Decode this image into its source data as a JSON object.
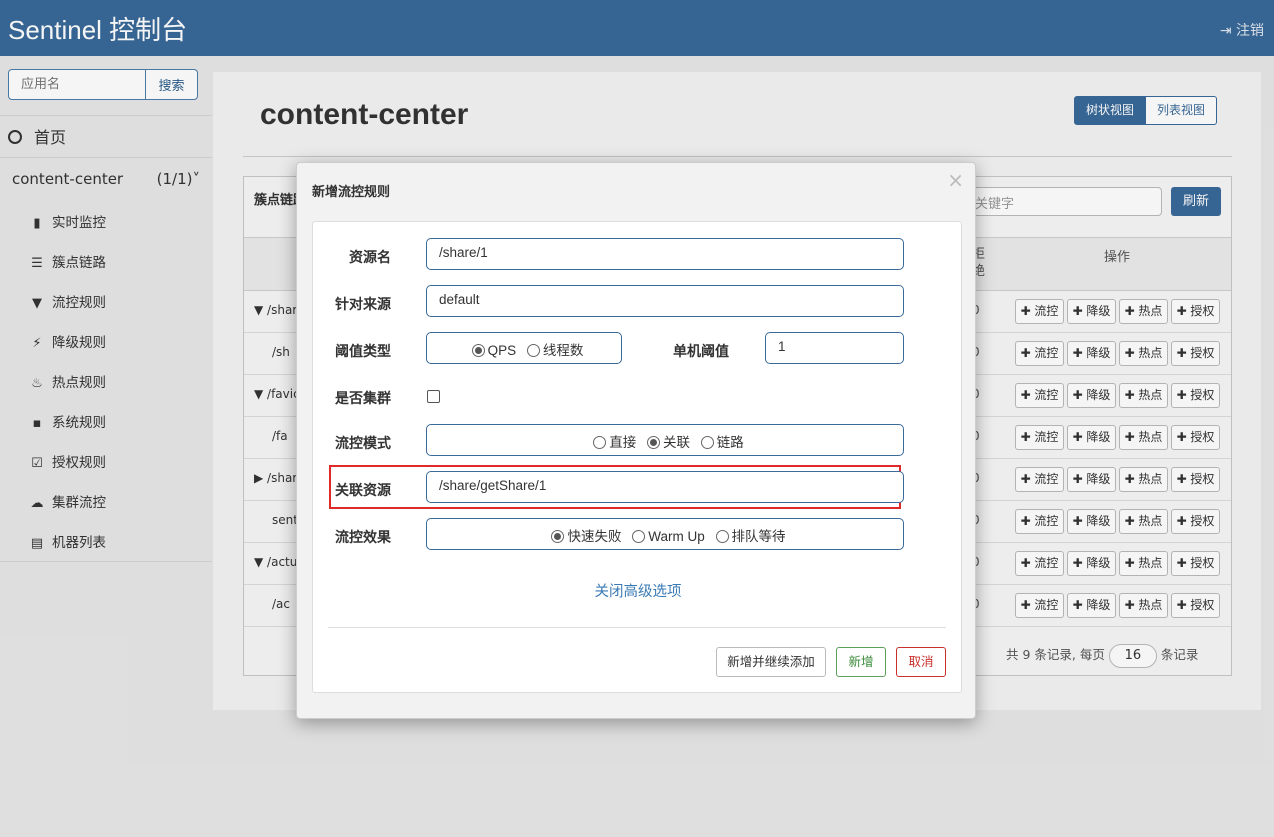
{
  "header": {
    "brand": "Sentinel 控制台",
    "logout": "注销"
  },
  "sidebar": {
    "search_placeholder": "应用名",
    "search_button": "搜索",
    "home": "首页",
    "app_name": "content-center",
    "app_count": "(1/1)",
    "items": [
      {
        "icon": "bar-chart-icon",
        "glyph": "▮",
        "label": "实时监控"
      },
      {
        "icon": "list-icon",
        "glyph": "☰",
        "label": "簇点链路"
      },
      {
        "icon": "filter-icon",
        "glyph": "▼",
        "label": "流控规则"
      },
      {
        "icon": "flash-icon",
        "glyph": "⚡",
        "label": "降级规则"
      },
      {
        "icon": "fire-icon",
        "glyph": "♨",
        "label": "热点规则"
      },
      {
        "icon": "lock-icon",
        "glyph": "▪",
        "label": "系统规则"
      },
      {
        "icon": "check-icon",
        "glyph": "☑",
        "label": "授权规则"
      },
      {
        "icon": "cloud-icon",
        "glyph": "☁",
        "label": "集群流控"
      },
      {
        "icon": "th-list-icon",
        "glyph": "▤",
        "label": "机器列表"
      }
    ]
  },
  "main": {
    "title": "content-center",
    "tree_view": "树状视图",
    "list_view": "列表视图",
    "panel_title": "簇点链路",
    "keyword_placeholder": "关键字",
    "refresh": "刷新",
    "col_reject_1": "拒",
    "col_reject_2": "绝",
    "col_ops": "操作",
    "rows": [
      "▼ /shar",
      "/sh",
      "▼ /favic",
      "/fa",
      "▶ /shar",
      "sentin",
      "▼ /actu",
      "/ac"
    ],
    "zero": "0",
    "op_labels": [
      "✚ 流控",
      "✚ 降级",
      "✚ 热点",
      "✚ 授权"
    ],
    "pager": {
      "prefix": "共 9 条记录, 每页",
      "page_size": "16",
      "suffix": "条记录"
    }
  },
  "modal": {
    "title": "新增流控规则",
    "close": "×",
    "resource_label": "资源名",
    "resource_value": "/share/1",
    "origin_label": "针对来源",
    "origin_value": "default",
    "grade_label": "阈值类型",
    "grade_qps": "QPS",
    "grade_thread": "线程数",
    "count_label": "单机阈值",
    "count_value": "1",
    "cluster_label": "是否集群",
    "strategy_label": "流控模式",
    "strategy_direct": "直接",
    "strategy_relate": "关联",
    "strategy_chain": "链路",
    "ref_label": "关联资源",
    "ref_value": "/share/getShare/1",
    "effect_label": "流控效果",
    "effect_fast": "快速失败",
    "effect_warmup": "Warm Up",
    "effect_queue": "排队等待",
    "advanced_toggle": "关闭高级选项",
    "btn_add_continue": "新增并继续添加",
    "btn_add": "新增",
    "btn_cancel": "取消"
  }
}
